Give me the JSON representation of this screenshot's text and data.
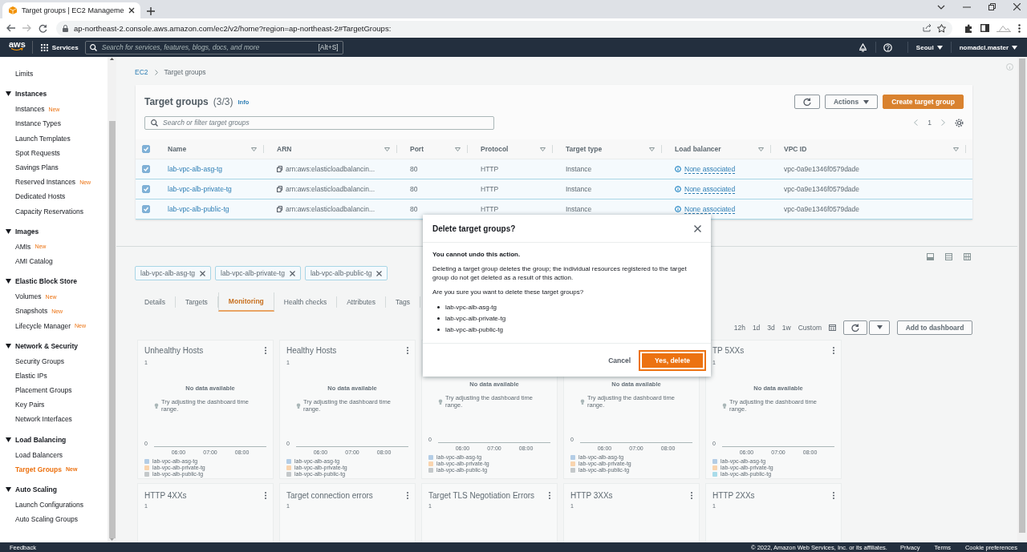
{
  "browser": {
    "tab_title": "Target groups | EC2 Manageme",
    "url": "ap-northeast-2.console.aws.amazon.com/ec2/v2/home?region=ap-northeast-2#TargetGroups:"
  },
  "header": {
    "logo": "aws",
    "services": "Services",
    "search_placeholder": "Search for services, features, blogs, docs, and more",
    "shortcut": "[Alt+S]",
    "region": "Seoul",
    "account": "nomadcl.master"
  },
  "sidebar": {
    "items": [
      {
        "label": "Limits",
        "selected": false
      }
    ],
    "sections": [
      {
        "title": "Instances",
        "expanded": true,
        "items": [
          {
            "label": "Instances",
            "badge": "New",
            "selected": false
          },
          {
            "label": "Instance Types",
            "selected": false
          },
          {
            "label": "Launch Templates",
            "selected": false
          },
          {
            "label": "Spot Requests",
            "selected": false
          },
          {
            "label": "Savings Plans",
            "selected": false
          },
          {
            "label": "Reserved Instances",
            "badge": "New",
            "selected": false
          },
          {
            "label": "Dedicated Hosts",
            "selected": false
          },
          {
            "label": "Capacity Reservations",
            "selected": false
          }
        ]
      },
      {
        "title": "Images",
        "expanded": true,
        "items": [
          {
            "label": "AMIs",
            "badge": "New",
            "selected": false
          },
          {
            "label": "AMI Catalog",
            "selected": false
          }
        ]
      },
      {
        "title": "Elastic Block Store",
        "expanded": true,
        "items": [
          {
            "label": "Volumes",
            "badge": "New",
            "selected": false
          },
          {
            "label": "Snapshots",
            "badge": "New",
            "selected": false
          },
          {
            "label": "Lifecycle Manager",
            "badge": "New",
            "selected": false
          }
        ]
      },
      {
        "title": "Network & Security",
        "expanded": true,
        "items": [
          {
            "label": "Security Groups",
            "selected": false
          },
          {
            "label": "Elastic IPs",
            "selected": false
          },
          {
            "label": "Placement Groups",
            "selected": false
          },
          {
            "label": "Key Pairs",
            "selected": false
          },
          {
            "label": "Network Interfaces",
            "selected": false
          }
        ]
      },
      {
        "title": "Load Balancing",
        "expanded": true,
        "items": [
          {
            "label": "Load Balancers",
            "selected": false
          },
          {
            "label": "Target Groups",
            "badge": "New",
            "selected": true
          }
        ]
      },
      {
        "title": "Auto Scaling",
        "expanded": true,
        "items": [
          {
            "label": "Launch Configurations",
            "selected": false
          },
          {
            "label": "Auto Scaling Groups",
            "selected": false
          }
        ]
      }
    ]
  },
  "breadcrumb": [
    "EC2",
    "Target groups"
  ],
  "target_groups": {
    "title": "Target groups",
    "count": "(3/3)",
    "info": "Info",
    "actions": "Actions",
    "create": "Create target group",
    "search_placeholder": "Search or filter target groups",
    "page": "1",
    "all_checked": true,
    "columns": [
      "Name",
      "ARN",
      "Port",
      "Protocol",
      "Target type",
      "Load balancer",
      "VPC ID"
    ],
    "rows": [
      {
        "selected": true,
        "cells": [
          "lab-vpc-alb-asg-tg",
          "arn:aws:elasticloadbalancin...",
          "80",
          "HTTP",
          "Instance",
          "None associated",
          "vpc-0a9e1346f0579dade"
        ]
      },
      {
        "selected": true,
        "cells": [
          "lab-vpc-alb-private-tg",
          "arn:aws:elasticloadbalancin...",
          "80",
          "HTTP",
          "Instance",
          "None associated",
          "vpc-0a9e1346f0579dade"
        ]
      },
      {
        "selected": true,
        "cells": [
          "lab-vpc-alb-public-tg",
          "arn:aws:elasticloadbalancin...",
          "80",
          "HTTP",
          "Instance",
          "None associated",
          "vpc-0a9e1346f0579dade"
        ]
      }
    ]
  },
  "selection_tokens": [
    "lab-vpc-alb-asg-tg",
    "lab-vpc-alb-private-tg",
    "lab-vpc-alb-public-tg"
  ],
  "detail_tabs": [
    {
      "label": "Details",
      "selected": false
    },
    {
      "label": "Targets",
      "selected": false
    },
    {
      "label": "Monitoring",
      "selected": true
    },
    {
      "label": "Health checks",
      "selected": false
    },
    {
      "label": "Attributes",
      "selected": false
    },
    {
      "label": "Tags",
      "selected": false
    }
  ],
  "time_ranges": [
    "12h",
    "1d",
    "3d",
    "1w",
    "Custom"
  ],
  "add_to_dashboard": "Add to dashboard",
  "metric_cards": [
    {
      "title": "Unhealthy Hosts",
      "y_max": "1",
      "y_min": "0",
      "message": "No data available",
      "hint": "Try adjusting the dashboard time range.",
      "x_ticks": [
        "06:00",
        "07:00",
        "08:00"
      ],
      "legend": [
        {
          "label": "lab-vpc-alb-asg-tg",
          "color": "#b3cde6"
        },
        {
          "label": "lab-vpc-alb-private-tg",
          "color": "#f9d4ae"
        },
        {
          "label": "lab-vpc-alb-public-tg",
          "color": "#c4c8ca"
        }
      ]
    },
    {
      "title": "Healthy Hosts",
      "y_max": "1",
      "y_min": "0",
      "message": "No data available",
      "hint": "Try adjusting the dashboard time range.",
      "x_ticks": [
        "06:00",
        "07:00",
        "08:00"
      ],
      "legend": [
        {
          "label": "lab-vpc-alb-asg-tg",
          "color": "#b3cde6"
        },
        {
          "label": "lab-vpc-alb-private-tg",
          "color": "#f9d4ae"
        },
        {
          "label": "lab-vpc-alb-public-tg",
          "color": "#c4c8ca"
        }
      ]
    },
    {
      "y_min": "0",
      "message": "No data available",
      "hint": "Try adjusting the dashboard time range.",
      "x_ticks": [
        "06:00",
        "07:00",
        "08:00"
      ],
      "legend": [
        {
          "label": "lab-vpc-alb-asg-tg",
          "color": "#b3cde6"
        },
        {
          "label": "lab-vpc-alb-private-tg",
          "color": "#f9d4ae"
        },
        {
          "label": "lab-vpc-alb-public-tg",
          "color": "#c4c8ca"
        }
      ]
    },
    {
      "y_min": "0",
      "message": "No data available",
      "hint": "Try adjusting the dashboard time range.",
      "x_ticks": [
        "06:00",
        "07:00",
        "08:00"
      ],
      "legend": [
        {
          "label": "lab-vpc-alb-asg-tg",
          "color": "#b3cde6"
        },
        {
          "label": "lab-vpc-alb-private-tg",
          "color": "#f9d4ae"
        },
        {
          "label": "lab-vpc-alb-public-tg",
          "color": "#c4c8ca"
        }
      ]
    },
    {
      "title": "TP 5XXs",
      "y_max": "1",
      "y_min": "0",
      "message": "No data available",
      "hint": "Try adjusting the dashboard time range.",
      "x_ticks": [
        "06:00",
        "07:00",
        "08:00"
      ],
      "legend": [
        {
          "label": "lab-vpc-alb-asg-tg",
          "color": "#b3cde6"
        },
        {
          "label": "lab-vpc-alb-private-tg",
          "color": "#f9d4ae"
        },
        {
          "label": "lab-vpc-alb-public-tg",
          "color": "#a9dcea"
        }
      ]
    }
  ],
  "metric_cards_row2": [
    {
      "title": "HTTP 4XXs",
      "y_max": "1"
    },
    {
      "title": "Target connection errors",
      "y_max": "1"
    },
    {
      "title": "Target TLS Negotiation Errors",
      "y_max": "1"
    },
    {
      "title": "HTTP 3XXs",
      "y_max": "1"
    },
    {
      "title": "HTTP 2XXs",
      "y_max": "1"
    }
  ],
  "modal": {
    "title": "Delete target groups?",
    "warning": "You cannot undo this action.",
    "body": "Deleting a target group deletes the group; the individual resources registered to the target group do not get deleted as a result of this action.",
    "question": "Are you sure you want to delete these target groups?",
    "items": [
      "lab-vpc-alb-asg-tg",
      "lab-vpc-alb-private-tg",
      "lab-vpc-alb-public-tg"
    ],
    "cancel": "Cancel",
    "confirm": "Yes, delete"
  },
  "footer": {
    "feedback": "Feedback",
    "copyright": "© 2022, Amazon Web Services, Inc. or its affiliates.",
    "links": [
      "Privacy",
      "Terms",
      "Cookie preferences"
    ]
  }
}
